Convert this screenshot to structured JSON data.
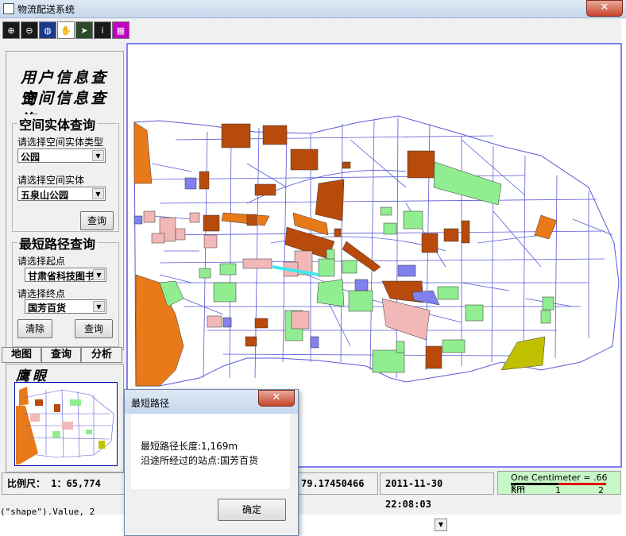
{
  "window": {
    "title": "物流配送系统",
    "close_label": "✕"
  },
  "toolbar": {
    "buttons": [
      {
        "name": "zoom-in-icon",
        "glyph": "⊕"
      },
      {
        "name": "zoom-out-icon",
        "glyph": "⊖"
      },
      {
        "name": "full-extent-icon",
        "glyph": "◍"
      },
      {
        "name": "pan-hand-icon",
        "glyph": "✋"
      },
      {
        "name": "select-arrow-icon",
        "glyph": "➤"
      },
      {
        "name": "identify-info-icon",
        "glyph": "i"
      },
      {
        "name": "measure-icon",
        "glyph": "▦"
      }
    ]
  },
  "left_panel": {
    "user_query_title": "用户信息查询",
    "spatial_query_title": "空间信息查询",
    "entity_group": {
      "title": "空间实体查询",
      "type_label": "请选择空间实体类型",
      "type_value": "公园",
      "entity_label": "请选择空间实体",
      "entity_value": "五泉山公园",
      "query_button": "查询"
    },
    "path_group": {
      "title": "最短路径查询",
      "start_label": "请选择起点",
      "start_value": "甘肃省科技图书",
      "end_label": "请选择终点",
      "end_value": "国芳百货",
      "clear_button": "清除",
      "query_button": "查询"
    },
    "tabs": [
      "地图",
      "查询",
      "分析"
    ],
    "eagle_title": "鹰眼"
  },
  "status": {
    "scale_label": "比例尺：",
    "scale_value": "1：65,774",
    "coord_text": "79.17450466",
    "datetime": "2011-11-30 22:08:03",
    "scalebar_title": "One Centimeter = .66 Km",
    "scalebar_km": "Km",
    "scalebar_1": "1",
    "scalebar_2": "2"
  },
  "dialog": {
    "title": "最短路径",
    "close_label": "✕",
    "length_text": "最短路径长度:1,169m",
    "stations_text": "沿途所经过的站点:国芳百货",
    "ok_button": "确定"
  },
  "code_text": "(\"shape\").Value, 2",
  "colors": {
    "road": "#5a5ad8",
    "orange": "#e87a1a",
    "brown": "#b84a0c",
    "green": "#90ee90",
    "pink": "#f2b8b8",
    "blue": "#8080ee",
    "olive": "#c0c000",
    "route": "#40e8f0",
    "scalebar_bg": "#c8f8c8"
  }
}
